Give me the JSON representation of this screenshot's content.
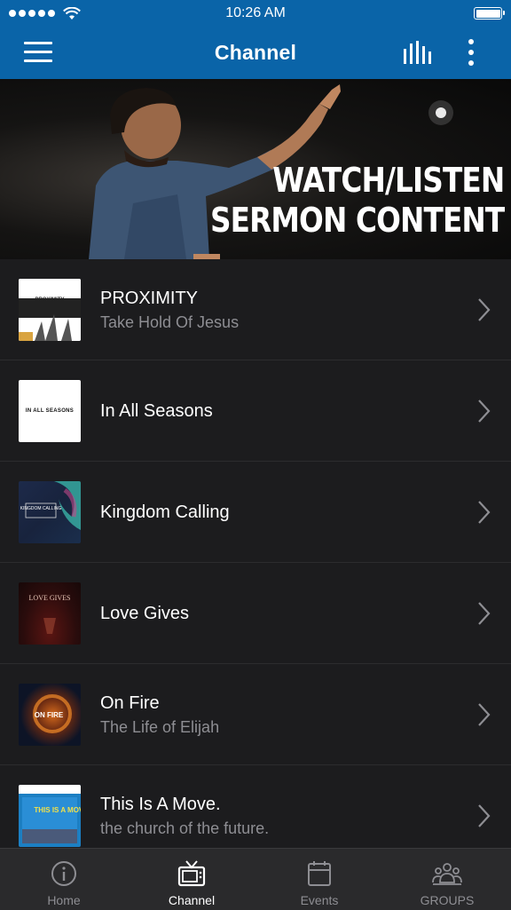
{
  "status": {
    "time": "10:26 AM"
  },
  "header": {
    "title": "Channel"
  },
  "hero": {
    "line1": "WATCH/LISTEN",
    "line2": "SERMON CONTENT"
  },
  "items": [
    {
      "title": "PROXIMITY",
      "subtitle": "Take Hold Of Jesus",
      "thumb_text": "PROXIMITY"
    },
    {
      "title": "In All Seasons",
      "subtitle": "",
      "thumb_text": "IN ALL SEASONS"
    },
    {
      "title": "Kingdom Calling",
      "subtitle": "",
      "thumb_text": "KINGDOM CALLING"
    },
    {
      "title": "Love Gives",
      "subtitle": "",
      "thumb_text": "LOVE GIVES"
    },
    {
      "title": "On Fire",
      "subtitle": "The Life of Elijah",
      "thumb_text": "ON FIRE"
    },
    {
      "title": "This Is A Move.",
      "subtitle": "the church of the future.",
      "thumb_text": "THIS IS A MOVE"
    }
  ],
  "tabs": [
    {
      "label": "Home",
      "icon": "info-icon"
    },
    {
      "label": "Channel",
      "icon": "tv-icon"
    },
    {
      "label": "Events",
      "icon": "calendar-icon"
    },
    {
      "label": "GROUPS",
      "icon": "groups-icon"
    }
  ],
  "colors": {
    "brand": "#0a64a8",
    "background": "#1c1c1e",
    "tabbar": "#2a2a2c"
  }
}
